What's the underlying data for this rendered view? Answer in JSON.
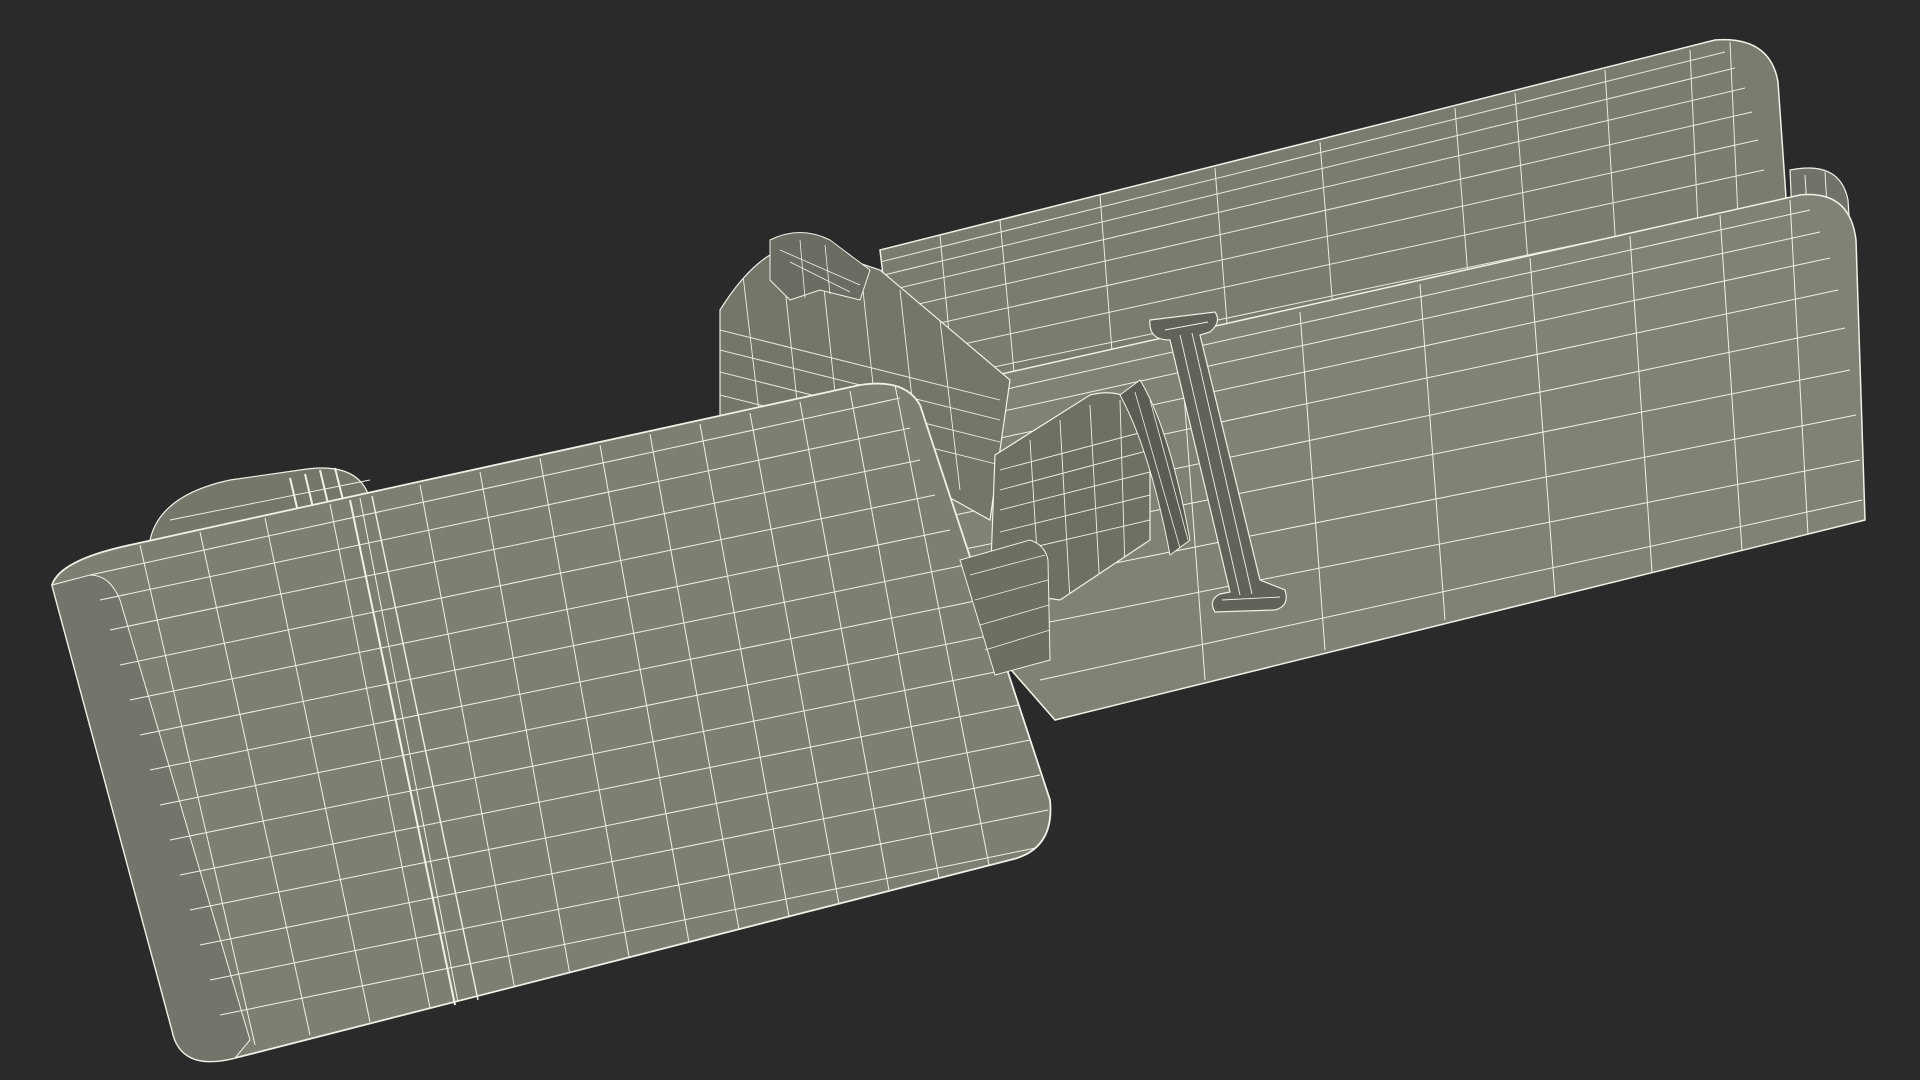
{
  "colors": {
    "background": "#2a2a2a",
    "surface": "#7a7a6e",
    "surface_light": "#838377",
    "surface_dark": "#66665b",
    "surface_shadow": "#5a5a50",
    "wire": "#f0f0e6"
  },
  "subject": {
    "render_style": "wireframe-over-shaded",
    "parts": [
      "body-handle",
      "cylinder-barrel",
      "front-cap",
      "clip",
      "head-joint"
    ]
  }
}
